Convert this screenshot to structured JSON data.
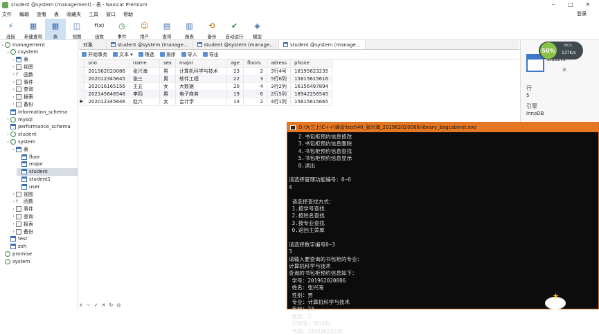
{
  "window": {
    "title": "student @system (management) - 表 - Navicat Premium",
    "minimize": "–",
    "maximize": "□",
    "close": "✕"
  },
  "menu": [
    "文件",
    "编辑",
    "查看",
    "表",
    "收藏夹",
    "工具",
    "窗口",
    "帮助"
  ],
  "login": "登录",
  "toolbar": [
    {
      "label": "连接",
      "icon": "connect-icon",
      "glyph": "⚡"
    },
    {
      "label": "新建查询",
      "icon": "new-query-icon",
      "glyph": "▦"
    },
    {
      "label": "表",
      "icon": "table-icon",
      "glyph": "▦"
    },
    {
      "label": "视图",
      "icon": "view-icon",
      "glyph": "◫"
    },
    {
      "label": "函数",
      "icon": "function-icon",
      "glyph": "f(x)"
    },
    {
      "label": "事件",
      "icon": "event-icon",
      "glyph": "◷"
    },
    {
      "label": "用户",
      "icon": "user-icon",
      "glyph": "☺"
    },
    {
      "label": "查询",
      "icon": "query-icon",
      "glyph": "▤"
    },
    {
      "label": "报表",
      "icon": "report-icon",
      "glyph": "▥"
    },
    {
      "label": "备份",
      "icon": "backup-icon",
      "glyph": "⟲"
    },
    {
      "label": "自动运行",
      "icon": "auto-run-icon",
      "glyph": "✔"
    },
    {
      "label": "模型",
      "icon": "model-icon",
      "glyph": "◈"
    }
  ],
  "tree": [
    {
      "label": "management",
      "type": "db",
      "depth": 0,
      "arrow": "⌄"
    },
    {
      "label": "csystem",
      "type": "db",
      "depth": 1,
      "arrow": "⌄"
    },
    {
      "label": "表",
      "type": "tbl",
      "depth": 2,
      "arrow": "›"
    },
    {
      "label": "视图",
      "type": "grp",
      "depth": 2,
      "arrow": "›"
    },
    {
      "label": "函数",
      "type": "fx",
      "depth": 2,
      "arrow": "›"
    },
    {
      "label": "事件",
      "type": "grp",
      "depth": 2,
      "arrow": "›"
    },
    {
      "label": "查询",
      "type": "grp",
      "depth": 2,
      "arrow": "›"
    },
    {
      "label": "报表",
      "type": "grp",
      "depth": 2,
      "arrow": "›"
    },
    {
      "label": "备份",
      "type": "grp",
      "depth": 2,
      "arrow": "›"
    },
    {
      "label": "information_schema",
      "type": "tbl",
      "depth": 1,
      "arrow": ""
    },
    {
      "label": "mysql",
      "type": "db",
      "depth": 1,
      "arrow": "›"
    },
    {
      "label": "performance_schema",
      "type": "tbl",
      "depth": 1,
      "arrow": ""
    },
    {
      "label": "student",
      "type": "db",
      "depth": 1,
      "arrow": "›"
    },
    {
      "label": "system",
      "type": "db",
      "depth": 1,
      "arrow": "⌄"
    },
    {
      "label": "表",
      "type": "tbl",
      "depth": 2,
      "arrow": "⌄"
    },
    {
      "label": "floor",
      "type": "tbl",
      "depth": 3,
      "arrow": ""
    },
    {
      "label": "major",
      "type": "tbl",
      "depth": 3,
      "arrow": ""
    },
    {
      "label": "student",
      "type": "tbl",
      "depth": 3,
      "arrow": "",
      "selected": true
    },
    {
      "label": "student1",
      "type": "tbl",
      "depth": 3,
      "arrow": ""
    },
    {
      "label": "user",
      "type": "tbl",
      "depth": 3,
      "arrow": ""
    },
    {
      "label": "视图",
      "type": "grp",
      "depth": 2,
      "arrow": "›"
    },
    {
      "label": "函数",
      "type": "fx",
      "depth": 2,
      "arrow": "›"
    },
    {
      "label": "事件",
      "type": "grp",
      "depth": 2,
      "arrow": "›"
    },
    {
      "label": "查询",
      "type": "grp",
      "depth": 2,
      "arrow": "›"
    },
    {
      "label": "报表",
      "type": "grp",
      "depth": 2,
      "arrow": "›"
    },
    {
      "label": "备份",
      "type": "grp",
      "depth": 2,
      "arrow": "›"
    },
    {
      "label": "test",
      "type": "tbl",
      "depth": 1,
      "arrow": ""
    },
    {
      "label": "zxh",
      "type": "tbl",
      "depth": 1,
      "arrow": ""
    },
    {
      "label": "promise",
      "type": "db",
      "depth": 0,
      "arrow": ""
    },
    {
      "label": "system",
      "type": "db",
      "depth": 0,
      "arrow": ""
    }
  ],
  "tabs": [
    "对象",
    "student @system (manage...",
    "student @system (manage...",
    "student @system (manage..."
  ],
  "table_toolbar": [
    "开始事务",
    "文本 ▾",
    "筛选",
    "排序",
    "导入",
    "导出"
  ],
  "grid": {
    "columns": [
      "sno",
      "name",
      "sex",
      "major",
      "age",
      "floors",
      "adress",
      "phone"
    ],
    "rows": [
      [
        "201962020086",
        "张兴海",
        "男",
        "计算机科学与技术",
        "23",
        "2",
        "3行4号",
        "18195623235"
      ],
      [
        "202012345645",
        "张三",
        "男",
        "软件工程",
        "22",
        "3",
        "5行6列",
        "15615615616"
      ],
      [
        "202016165156",
        "王五",
        "女",
        "大数据",
        "20",
        "4",
        "3行2列",
        "16156497894"
      ],
      [
        "202145646546",
        "李四",
        "男",
        "电子商务",
        "19",
        "6",
        "2行5列",
        "18942256545"
      ],
      [
        "202012345646",
        "赵六",
        "女",
        "会计学",
        "13",
        "2",
        "4行1列",
        "15615615665"
      ]
    ]
  },
  "right_panel": {
    "name": "student",
    "subtitle": "表",
    "rows_label": "行",
    "rows_value": "5",
    "engine_label": "引擎",
    "engine_value": "InnoDB"
  },
  "speed_widget": {
    "percent": "50%",
    "up": "0K/s",
    "down": "137K/s"
  },
  "console": {
    "title": "D:\\大三上\\C++\\课设\\test\\40_张兴海_201962020086\\library_bagcabinet.exe",
    "lines": [
      "   2.书包柜预约信息修改",
      "   3.书包柜预约信息删除",
      "   4.书包柜预约信息查找",
      "   5.书包柜预约信息显示",
      "   0.退出",
      "",
      "请选择管理功能编号：0~6",
      "4",
      "",
      " 请选择查找方式：",
      " 1.按学号查找",
      " 2.按姓名查找",
      " 3.按专业查找",
      " 0.返回主菜单",
      "",
      "请选择数字编号0~3",
      "3",
      "请输入要查询的书包柜的专业：",
      "计算机科学与技术",
      "查询的书包柜预约信息如下：",
      " 学号：201962020086",
      " 姓名：张兴海",
      " 性别：男",
      " 专业：计算机科学与技术",
      " 年龄：23",
      " 楼层：2",
      " 行列号：3行4列",
      " 电话：18195623235"
    ]
  },
  "status_icons": [
    "+",
    "−",
    "✓",
    "✕",
    "↻",
    "◎"
  ]
}
